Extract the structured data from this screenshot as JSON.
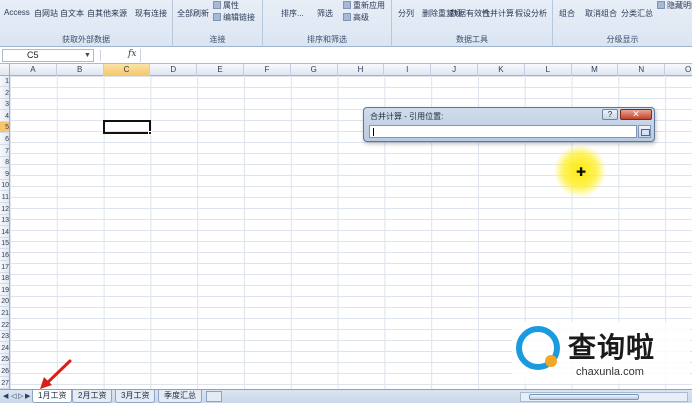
{
  "ribbon": {
    "groups": [
      {
        "label": "获取外部数据",
        "buttons": [
          "Access",
          "自网站",
          "自文本",
          "自其他来源",
          "现有连接"
        ]
      },
      {
        "label": "连接",
        "buttons": [
          "全部刷新",
          "属性",
          "编辑链接"
        ]
      },
      {
        "label": "排序和筛选",
        "buttons": [
          "排序...",
          "筛选",
          "重新应用",
          "高级"
        ]
      },
      {
        "label": "数据工具",
        "buttons": [
          "分列",
          "删除重复项",
          "数据有效性",
          "合并计算",
          "假设分析"
        ]
      },
      {
        "label": "分级显示",
        "buttons": [
          "组合",
          "取消组合",
          "分类汇总",
          "隐藏明细"
        ]
      }
    ]
  },
  "formula_bar": {
    "name_box": "C5",
    "fx_label": "fx",
    "formula": ""
  },
  "grid": {
    "columns": [
      "A",
      "B",
      "C",
      "D",
      "E",
      "F",
      "G",
      "H",
      "I",
      "J",
      "K",
      "L",
      "M",
      "N",
      "O"
    ],
    "rows": [
      "1",
      "2",
      "3",
      "4",
      "5",
      "6",
      "7",
      "8",
      "9",
      "10",
      "11",
      "12",
      "13",
      "14",
      "15",
      "16",
      "17",
      "18",
      "19",
      "20",
      "21",
      "22",
      "23",
      "24",
      "25",
      "26",
      "27"
    ],
    "active_cell": "C5"
  },
  "dialog": {
    "title": "合并计算 - 引用位置:",
    "help_label": "?",
    "close_label": "✕",
    "reference_value": ""
  },
  "sheet_tabs": {
    "tabs": [
      "1月工资",
      "2月工资",
      "3月工资",
      "季度汇总"
    ],
    "active": "1月工资"
  },
  "watermark": {
    "brand": "查询啦",
    "url": "chaxunla.com"
  },
  "colors": {
    "accent": "#1a9be0",
    "highlight": "#ffe800",
    "annotation": "#d6201a"
  }
}
